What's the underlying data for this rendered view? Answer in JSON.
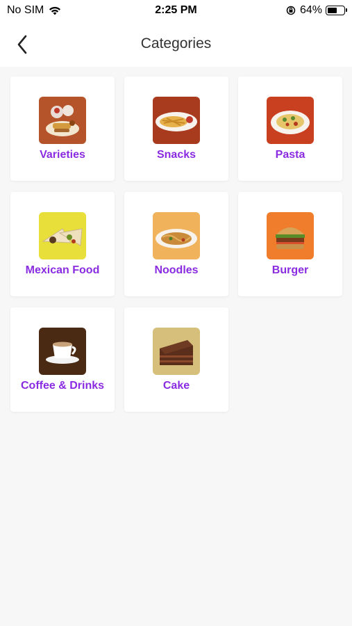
{
  "status_bar": {
    "carrier": "No SIM",
    "time": "2:25 PM",
    "battery": "64%",
    "battery_level": 0.64
  },
  "header": {
    "title": "Categories"
  },
  "colors": {
    "accent": "#8a2be2",
    "background": "#f7f7f7",
    "card": "#ffffff"
  },
  "categories": [
    {
      "label": "Varieties",
      "icon": "varieties-image",
      "bg": "#b5542a"
    },
    {
      "label": "Snacks",
      "icon": "snacks-image",
      "bg": "#a83a1e"
    },
    {
      "label": "Pasta",
      "icon": "pasta-image",
      "bg": "#c8401f"
    },
    {
      "label": "Mexican Food",
      "icon": "mexican-food-image",
      "bg": "#e9df3a"
    },
    {
      "label": "Noodles",
      "icon": "noodles-image",
      "bg": "#f0b25a"
    },
    {
      "label": "Burger",
      "icon": "burger-image",
      "bg": "#ef7d2c"
    },
    {
      "label": "Coffee & Drinks",
      "icon": "coffee-image",
      "bg": "#4a2a12"
    },
    {
      "label": "Cake",
      "icon": "cake-image",
      "bg": "#d6bf7a"
    }
  ]
}
